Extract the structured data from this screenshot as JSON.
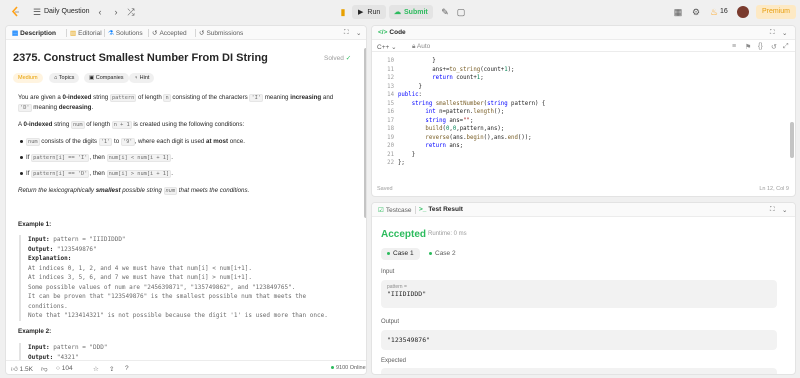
{
  "topbar": {
    "daily_question": "Daily Question",
    "run": "Run",
    "submit": "Submit",
    "streak": "16",
    "premium": "Premium"
  },
  "left_tabs": [
    "Description",
    "Editorial",
    "Solutions",
    "Accepted",
    "Submissions"
  ],
  "problem": {
    "title": "2375. Construct Smallest Number From DI String",
    "solved": "Solved",
    "difficulty": "Medium",
    "tags": [
      "Topics",
      "Companies",
      "Hint"
    ],
    "p1_a": "You are given a ",
    "p1_b": "0-indexed",
    "p1_c": " string ",
    "p1_code1": "pattern",
    "p1_d": " of length ",
    "p1_code2": "n",
    "p1_e": " consisting of the characters ",
    "p1_code3": "'I'",
    "p1_f": " meaning ",
    "p1_g": "increasing",
    "p1_h": " and",
    "p2_code": "'D'",
    "p2_a": " meaning ",
    "p2_b": "decreasing",
    "p2_c": ".",
    "p3_a": "A ",
    "p3_b": "0-indexed",
    "p3_c": " string ",
    "p3_code1": "num",
    "p3_d": " of length ",
    "p3_code2": "n + 1",
    "p3_e": " is created using the following conditions:",
    "b1_code": "num",
    "b1_a": " consists of the digits ",
    "b1_code2": "'1'",
    "b1_b": " to ",
    "b1_code3": "'9'",
    "b1_c": ", where each digit is used ",
    "b1_d": "at most",
    "b1_e": " once.",
    "b2_a": "If ",
    "b2_code1": "pattern[i] == 'I'",
    "b2_b": ", then ",
    "b2_code2": "num[i] < num[i + 1]",
    "b2_c": ".",
    "b3_a": "If ",
    "b3_code1": "pattern[i] == 'D'",
    "b3_b": ", then ",
    "b3_code2": "num[i] > num[i + 1]",
    "b3_c": ".",
    "ret_a": "Return the lexicographically ",
    "ret_b": "smallest",
    "ret_c": " possible string ",
    "ret_code": "num",
    "ret_d": " that meets the conditions."
  },
  "example1": {
    "title": "Example 1:",
    "input_label": "Input:",
    "input": " pattern = \"IIIDIDDD\"",
    "output_label": "Output:",
    "output": " \"123549876\"",
    "expl_label": "Explanation:",
    "lines": [
      "At indices 0, 1, 2, and 4 we must have that num[i] < num[i+1].",
      "At indices 3, 5, 6, and 7 we must have that num[i] > num[i+1].",
      "Some possible values of num are \"245639871\", \"135749862\", and \"123849765\".",
      "It can be proven that \"123549876\" is the smallest possible num that meets the",
      "conditions.",
      "Note that \"123414321\" is not possible because the digit '1' is used more than once."
    ]
  },
  "example2": {
    "title": "Example 2:",
    "input_label": "Input:",
    "input": " pattern = \"DDD\"",
    "output_label": "Output:",
    "output": " \"4321\""
  },
  "left_footer": {
    "likes": "1.5K",
    "comments": "104",
    "online": "9100 Online"
  },
  "code_panel": {
    "tab": "Code",
    "lang": "C++",
    "auto": "Auto",
    "saved": "Saved",
    "position": "Ln 12, Col 9",
    "line_numbers": [
      "10",
      "11",
      "12",
      "13",
      "14",
      "15",
      "16",
      "17",
      "18",
      "19",
      "20",
      "21",
      "22"
    ]
  },
  "result_panel": {
    "tabs": [
      "Testcase",
      "Test Result"
    ],
    "status": "Accepted",
    "runtime": "Runtime: 0 ms",
    "cases": [
      "Case 1",
      "Case 2"
    ],
    "input_label": "Input",
    "input_key": "pattern =",
    "input_value": "\"IIIDIDDD\"",
    "output_label": "Output",
    "output_value": "\"123549876\"",
    "expected_label": "Expected"
  },
  "colors": {
    "accent_green": "#2cbb5d",
    "medium": "#e7a000",
    "premium": "#e79e0e"
  }
}
